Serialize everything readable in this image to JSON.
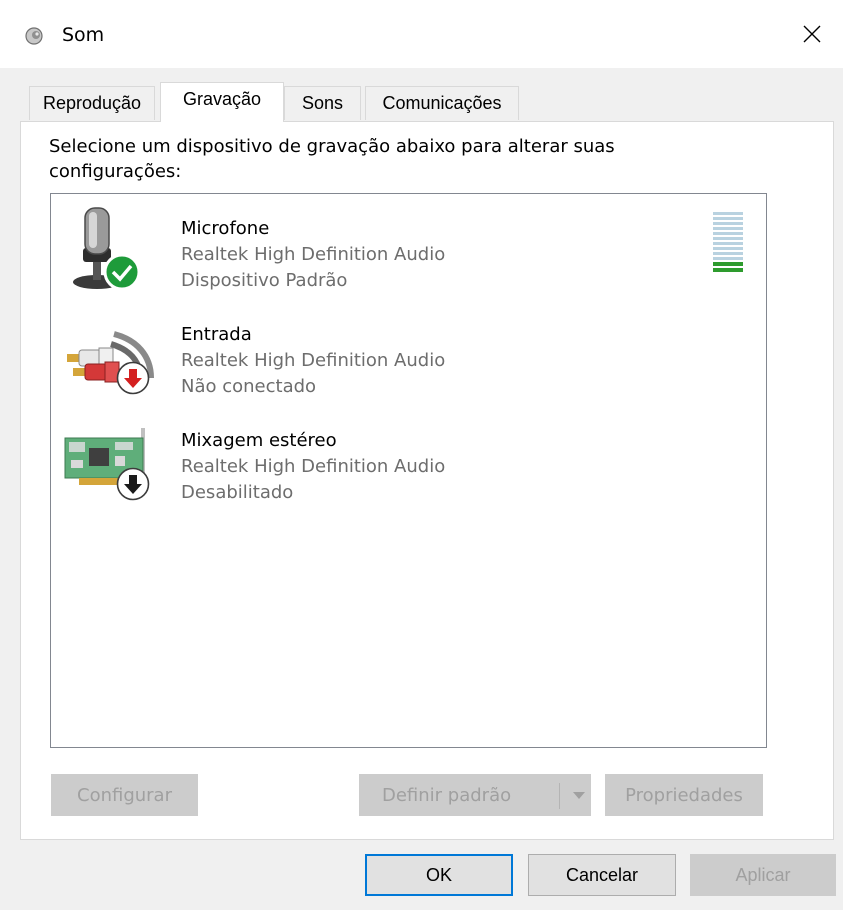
{
  "window": {
    "title": "Som"
  },
  "tabs": [
    {
      "label": "Reprodução"
    },
    {
      "label": "Gravação"
    },
    {
      "label": "Sons"
    },
    {
      "label": "Comunicações"
    }
  ],
  "active_tab": "Gravação",
  "instructions": "Selecione um dispositivo de gravação abaixo para alterar suas configurações:",
  "devices": [
    {
      "name": "Microfone",
      "driver": "Realtek High Definition Audio",
      "status": "Dispositivo Padrão",
      "icon": "microphone-icon",
      "badge": "default-check-icon",
      "level_fraction": 0.2
    },
    {
      "name": "Entrada",
      "driver": "Realtek High Definition Audio",
      "status": "Não conectado",
      "icon": "line-in-cable-icon",
      "badge": "unplugged-arrow-icon"
    },
    {
      "name": "Mixagem estéreo",
      "driver": "Realtek High Definition Audio",
      "status": "Desabilitado",
      "icon": "sound-card-icon",
      "badge": "disabled-arrow-icon"
    }
  ],
  "buttons": {
    "configure": "Configurar",
    "set_default": "Definir padrão",
    "properties": "Propriedades",
    "ok": "OK",
    "cancel": "Cancelar",
    "apply": "Aplicar"
  },
  "colors": {
    "accent": "#0078d7",
    "level_on": "#2e9b2e",
    "level_off": "#b9d2e0",
    "default_badge": "#1e9b3a",
    "unplugged_badge": "#d42020"
  }
}
